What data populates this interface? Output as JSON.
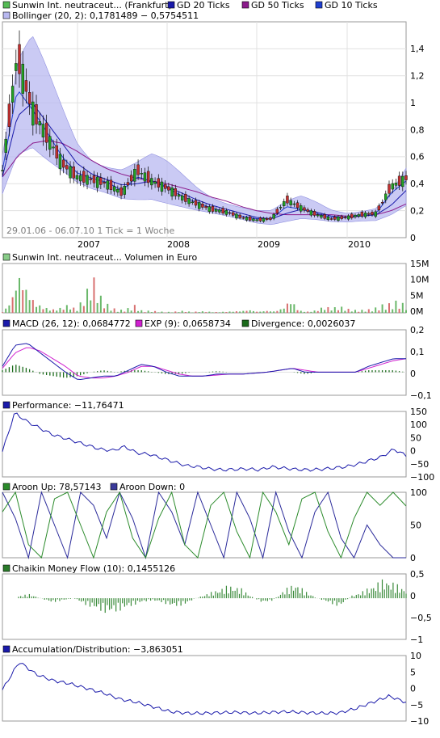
{
  "colors": {
    "price_up": "#22a022",
    "price_down": "#c23030",
    "gd20": "#1a1aaa",
    "gd50": "#8b1a8b",
    "gd10": "#1f3fd0",
    "bollinger": "#b8b8f0",
    "volume_up": "#6ab86a",
    "volume_down": "#d87070",
    "macd": "#1a1aaa",
    "exp": "#d020d0",
    "divergence": "#1a6a1a",
    "performance": "#1a1aaa",
    "aroon_up": "#2a8a2a",
    "aroon_down": "#2a2a9a",
    "chaikin": "#3a8a3a",
    "accdist": "#1a1aaa"
  },
  "legend_main": [
    {
      "label": "Sunwin Int. neutraceut... (Frankfurt)",
      "color": "#55bb55"
    },
    {
      "label": "GD 20 Ticks",
      "color": "#1a1aaa"
    },
    {
      "label": "GD 50 Ticks",
      "color": "#8b1a8b"
    },
    {
      "label": "GD 10 Ticks",
      "color": "#1f3fd0"
    }
  ],
  "legend_bollinger": {
    "label": "Bollinger (20, 2): 0,1781489 − 0,5754511",
    "color": "#b8b8f0"
  },
  "price_info": "29.01.06 - 06.07.10   1 Tick = 1 Woche",
  "x_axis": {
    "labels": [
      "2007",
      "2008",
      "2009",
      "2010"
    ]
  },
  "panels": {
    "price": {
      "ticks": [
        "1,4",
        "1,2",
        "1",
        "0,8",
        "0,6",
        "0,4",
        "0,2",
        "0"
      ]
    },
    "volume": {
      "legend": "Sunwin Int. neutraceut... Volumen in Euro",
      "legend_color": "#88cc88",
      "ticks": [
        "15M",
        "10M",
        "5M",
        "0M"
      ]
    },
    "macd": {
      "legend": [
        {
          "label": "MACD (26, 12): 0,0684772",
          "color": "#1a1aaa"
        },
        {
          "label": "EXP (9): 0,0658734",
          "color": "#d020d0"
        },
        {
          "label": "Divergence: 0,0026037",
          "color": "#1a6a1a"
        }
      ],
      "ticks": [
        "0,2",
        "0,1",
        "0",
        "−0,1"
      ]
    },
    "performance": {
      "legend": "Performance: −11,76471",
      "legend_color": "#1a1aaa",
      "ticks": [
        "150",
        "100",
        "50",
        "0",
        "−50",
        "−100"
      ]
    },
    "aroon": {
      "legend": [
        {
          "label": "Aroon Up: 78,57143",
          "color": "#2a8a2a"
        },
        {
          "label": "Aroon Down: 0",
          "color": "#3a3a9a"
        }
      ],
      "ticks": [
        "100",
        "50",
        "0"
      ]
    },
    "chaikin": {
      "legend": "Chaikin Money Flow (10): 0,1455126",
      "legend_color": "#2a7a2a",
      "ticks": [
        "0,5",
        "0",
        "−0,5",
        "−1"
      ]
    },
    "accdist": {
      "legend": "Accumulation/Distribution: −3,863051",
      "legend_color": "#1a1aaa",
      "ticks": [
        "10",
        "5",
        "0",
        "−5",
        "−10"
      ]
    }
  },
  "chart_data": [
    {
      "type": "line",
      "title": "Sunwin Int. neutraceut... (Frankfurt)",
      "x": [
        "2006-02",
        "2006-04",
        "2006-06",
        "2006-08",
        "2006-10",
        "2006-12",
        "2007-02",
        "2007-04",
        "2007-06",
        "2007-08",
        "2007-10",
        "2007-12",
        "2008-02",
        "2008-04",
        "2008-06",
        "2008-08",
        "2008-10",
        "2008-12",
        "2009-01",
        "2009-03",
        "2009-05",
        "2009-07",
        "2009-09",
        "2009-11",
        "2010-01",
        "2010-03",
        "2010-05",
        "2010-07"
      ],
      "ylim": [
        0,
        1.5
      ],
      "series": [
        {
          "name": "Sunwin Int. neutraceut... (Frankfurt)",
          "values": [
            0.5,
            1.35,
            0.95,
            0.75,
            0.55,
            0.45,
            0.43,
            0.4,
            0.33,
            0.5,
            0.42,
            0.37,
            0.3,
            0.25,
            0.21,
            0.19,
            0.15,
            0.13,
            0.14,
            0.28,
            0.22,
            0.17,
            0.14,
            0.15,
            0.17,
            0.18,
            0.38,
            0.44
          ]
        },
        {
          "name": "GD 20 Ticks",
          "values": [
            0.45,
            0.9,
            1.0,
            0.85,
            0.7,
            0.55,
            0.47,
            0.43,
            0.39,
            0.4,
            0.42,
            0.38,
            0.33,
            0.28,
            0.24,
            0.21,
            0.18,
            0.15,
            0.14,
            0.18,
            0.21,
            0.19,
            0.16,
            0.15,
            0.16,
            0.17,
            0.24,
            0.35
          ]
        },
        {
          "name": "GD 50 Ticks",
          "values": [
            0.45,
            0.6,
            0.7,
            0.72,
            0.7,
            0.64,
            0.57,
            0.51,
            0.47,
            0.44,
            0.42,
            0.4,
            0.37,
            0.34,
            0.3,
            0.27,
            0.23,
            0.2,
            0.18,
            0.17,
            0.17,
            0.17,
            0.17,
            0.16,
            0.16,
            0.17,
            0.2,
            0.25
          ]
        },
        {
          "name": "GD 10 Ticks",
          "values": [
            0.5,
            1.1,
            0.95,
            0.78,
            0.6,
            0.48,
            0.44,
            0.41,
            0.35,
            0.45,
            0.42,
            0.37,
            0.31,
            0.26,
            0.22,
            0.19,
            0.16,
            0.14,
            0.14,
            0.23,
            0.21,
            0.18,
            0.15,
            0.15,
            0.17,
            0.18,
            0.33,
            0.42
          ]
        }
      ]
    },
    {
      "type": "bar",
      "title": "Sunwin Int. neutraceut... Volumen in Euro",
      "ylim": [
        0,
        16
      ],
      "values_million": [
        0.2,
        3,
        10.5,
        6,
        2.5,
        1.5,
        0.8,
        1.2,
        2,
        0.8,
        4.2,
        8.5,
        3.5,
        1.5,
        0.6,
        0.8,
        1.8,
        0.4,
        0.5,
        0.3,
        0.2,
        0.3,
        0.5,
        0.2,
        0.4,
        0.3,
        0.2,
        0.3,
        0.4,
        0.5,
        0.8,
        0.3,
        0.6,
        0.4,
        1.2,
        3.5,
        0.6,
        0.3,
        0.6,
        1.5,
        1.2,
        1.5,
        0.9,
        0.6,
        0.7,
        0.9,
        1.8,
        2.1,
        2.8,
        1.7
      ]
    },
    {
      "type": "line",
      "title": "MACD (26, 12)",
      "ylim": [
        -0.12,
        0.22
      ],
      "series": [
        {
          "name": "MACD (26, 12)",
          "values": [
            0.03,
            0.14,
            0.15,
            0.1,
            0.05,
            0.0,
            -0.04,
            -0.03,
            -0.02,
            -0.02,
            0.01,
            0.04,
            0.03,
            0.0,
            -0.02,
            -0.02,
            -0.02,
            -0.01,
            -0.01,
            -0.01,
            -0.005,
            0.0,
            0.01,
            0.02,
            0.0,
            0.0,
            0.0,
            0.0,
            0.0,
            0.03,
            0.05,
            0.07,
            0.07
          ]
        },
        {
          "name": "EXP (9)",
          "values": [
            0.02,
            0.1,
            0.13,
            0.11,
            0.07,
            0.03,
            -0.02,
            -0.03,
            -0.03,
            -0.02,
            0.0,
            0.03,
            0.03,
            0.01,
            -0.01,
            -0.02,
            -0.02,
            -0.015,
            -0.01,
            -0.01,
            -0.005,
            0.0,
            0.01,
            0.02,
            0.01,
            0.0,
            0.0,
            0.0,
            0.0,
            0.02,
            0.04,
            0.06,
            0.07
          ]
        }
      ]
    },
    {
      "type": "line",
      "title": "Performance",
      "ylim": [
        -100,
        160
      ],
      "series": [
        {
          "name": "Performance",
          "values": [
            0,
            155,
            120,
            95,
            70,
            55,
            40,
            25,
            10,
            5,
            20,
            -5,
            -10,
            -25,
            -40,
            -55,
            -60,
            -68,
            -72,
            -70,
            -68,
            -72,
            -60,
            -65,
            -70,
            -72,
            -70,
            -65,
            -60,
            -50,
            -35,
            -20,
            10,
            -15
          ]
        }
      ]
    },
    {
      "type": "line",
      "title": "Aroon",
      "ylim": [
        0,
        100
      ],
      "series": [
        {
          "name": "Aroon Up",
          "values": [
            70,
            100,
            20,
            0,
            90,
            100,
            50,
            0,
            70,
            100,
            30,
            0,
            60,
            100,
            20,
            0,
            80,
            100,
            40,
            0,
            100,
            70,
            20,
            90,
            100,
            40,
            0,
            60,
            100,
            80,
            100,
            79
          ]
        },
        {
          "name": "Aroon Down",
          "values": [
            100,
            60,
            0,
            100,
            50,
            0,
            100,
            80,
            30,
            100,
            60,
            0,
            100,
            70,
            20,
            100,
            50,
            0,
            100,
            60,
            0,
            100,
            40,
            0,
            70,
            100,
            30,
            0,
            50,
            20,
            0,
            0
          ]
        }
      ]
    },
    {
      "type": "bar",
      "title": "Chaikin Money Flow (10)",
      "ylim": [
        -1,
        0.6
      ],
      "values": [
        0.05,
        0.1,
        0.0,
        -0.1,
        -0.05,
        0.0,
        -0.15,
        -0.25,
        -0.35,
        -0.3,
        -0.2,
        -0.1,
        -0.05,
        -0.1,
        -0.2,
        -0.15,
        0.0,
        0.1,
        0.2,
        0.3,
        0.25,
        0.05,
        -0.1,
        -0.05,
        0.2,
        0.35,
        0.15,
        0.0,
        -0.1,
        -0.2,
        0.05,
        0.15,
        0.3,
        0.45,
        0.35,
        0.2
      ]
    },
    {
      "type": "line",
      "title": "Accumulation/Distribution",
      "ylim": [
        -10,
        11
      ],
      "series": [
        {
          "name": "Accumulation/Distribution",
          "values": [
            0,
            9,
            5,
            3,
            2,
            0.5,
            -1,
            -3,
            -4,
            -5.5,
            -7,
            -7.5,
            -7.5,
            -7.3,
            -7.2,
            -7.5,
            -7.2,
            -7,
            -7.3,
            -7.5,
            -7.4,
            -6,
            -4,
            -2,
            -4
          ]
        }
      ]
    }
  ]
}
